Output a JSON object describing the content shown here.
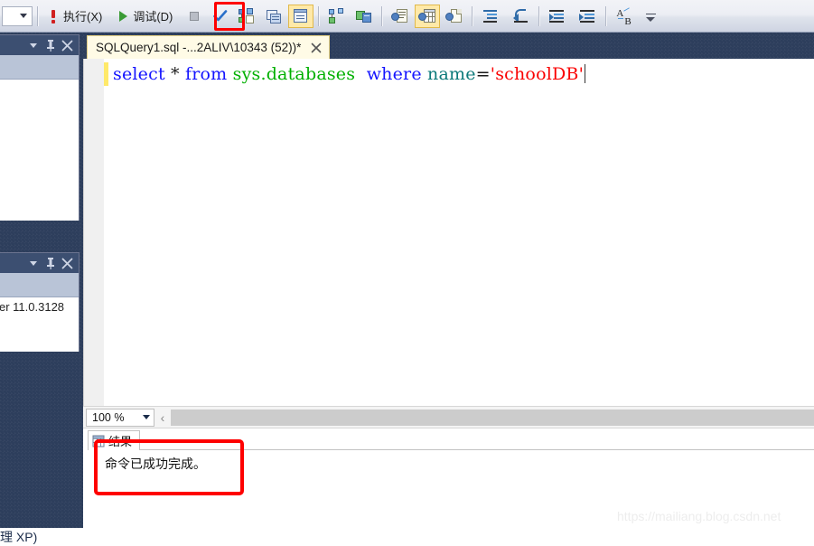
{
  "toolbar": {
    "combo_value": "",
    "execute_label": "执行(X)",
    "execute_mnemonic": "X",
    "debug_label": "调试(D)",
    "debug_mnemonic": "D",
    "icons": {
      "execute": "exclamation-icon",
      "debug": "play-icon",
      "stop": "stop-icon",
      "parse": "check-icon",
      "display_estimated_plan": "estimated-execution-plan-icon",
      "query_options": "query-options-icon",
      "intellisense": "intellisense-icon",
      "include_actual_plan": "actual-execution-plan-icon",
      "include_client_statistics": "client-statistics-icon",
      "results_to_text": "results-to-text-icon",
      "results_to_grid": "results-to-grid-icon",
      "results_to_file": "results-to-file-icon",
      "comment_lines": "comment-icon",
      "uncomment_lines": "uncomment-icon",
      "decrease_indent": "decrease-indent-icon",
      "increase_indent": "increase-indent-icon",
      "specify_values": "specify-values-icon",
      "overflow": "toolbar-overflow-icon"
    },
    "selected_buttons": [
      "results-to-text-icon",
      "results-to-grid-icon"
    ],
    "annotation_color": "#fe0000"
  },
  "sidebar": {
    "panels": [
      {
        "buttons": [
          "dropdown-icon",
          "pin-icon",
          "close-icon"
        ],
        "text": ""
      },
      {
        "buttons": [
          "dropdown-icon",
          "pin-icon",
          "close-icon"
        ],
        "text": "er 11.0.3128"
      }
    ],
    "bottom_text": "理 XP)"
  },
  "tab": {
    "title": "SQLQuery1.sql -...2ALIV\\10343 (52))*",
    "close_label": "×"
  },
  "editor": {
    "code": {
      "select": "select",
      "star": "*",
      "from": "from",
      "schema_table": "sys.databases",
      "where": "where",
      "column": "name",
      "equals": "=",
      "string_value": "'schoolDB'"
    },
    "colors": {
      "keyword": "#1414ff",
      "identifier_green": "#00b000",
      "column_teal": "#0c7a7a",
      "string_red": "#fa0000",
      "change_marker": "#ffe96a"
    }
  },
  "zoombar": {
    "zoom_value": "100 %",
    "scroll_left_label": "‹"
  },
  "results": {
    "tab_label": "结果",
    "message": "命令已成功完成。",
    "annotation_color": "#fe0000"
  },
  "watermark": {
    "text": "https://mailiang.blog.csdn.net"
  }
}
